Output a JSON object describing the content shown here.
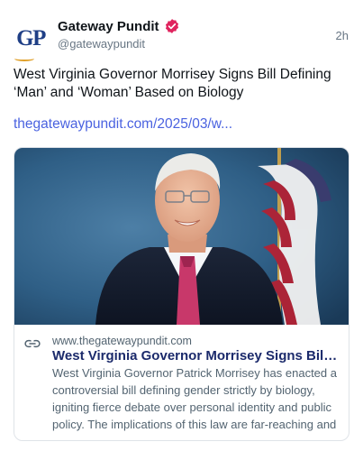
{
  "author": {
    "avatar_text": "GP",
    "name": "Gateway Pundit",
    "handle": "@gatewaypundit",
    "verified_icon": "verified-badge-icon",
    "verified_color": "#e0245e"
  },
  "post": {
    "timestamp": "2h",
    "text": "West Virginia Governor Morrisey Signs Bill Defining ‘Man’ and ‘Woman’ Based on Biology",
    "link_text": "thegatewaypundit.com/2025/03/w..."
  },
  "card": {
    "image_subject": "man-in-suit-with-american-flag",
    "link_icon": "link-icon",
    "domain": "www.thegatewaypundit.com",
    "title": "West Virginia Governor Morrisey Signs Bill Defining ‘Man’ and ‘Woman’ Based on Biology",
    "description": "West Virginia Governor Patrick Morrisey has enacted a controversial bill defining gender strictly by biology, igniting fierce debate over personal identity and public policy. The implications of this law are far-reaching and"
  },
  "colors": {
    "link": "#4a62e0",
    "card_title": "#1b2a6b",
    "muted": "#687684"
  }
}
